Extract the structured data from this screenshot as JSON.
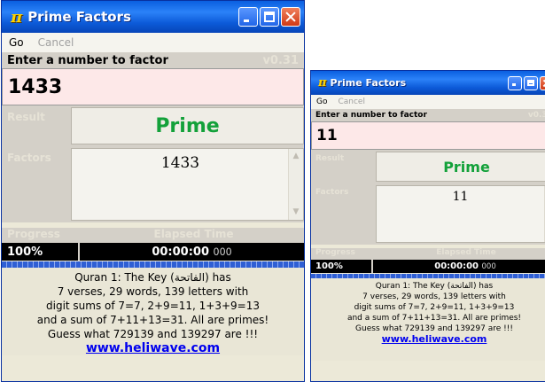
{
  "app": {
    "icon": "pi-icon",
    "title": "Prime Factors",
    "menu": {
      "go": "Go",
      "cancel": "Cancel"
    },
    "prompt": "Enter a number to factor",
    "version": "v0.31",
    "result_label": "Result",
    "factors_label": "Factors",
    "progress_label": "Progress",
    "elapsed_label": "Elapsed Time",
    "info_lines": [
      "Quran 1: The Key (الفاتحة) has",
      "7 verses, 29 words, 139 letters with",
      "digit sums of 7=7, 2+9=11, 1+3+9=13",
      "and a sum of 7+11+13=31. All are primes!",
      "Guess what 729139 and 139297 are !!!"
    ],
    "link": "www.heliwave.com",
    "accent_colors": {
      "title_bar": "#0a5fe0",
      "result_text": "#13a13a",
      "input_bg": "#fde8e8",
      "link": "#0000ee"
    }
  },
  "windows": [
    {
      "number": "1433",
      "result": "Prime",
      "factors": "1433",
      "progress": "100%",
      "elapsed": "00:00:00",
      "elapsed_ms": "000",
      "progress_fraction": 1.0
    },
    {
      "number": "11",
      "result": "Prime",
      "factors": "11",
      "progress": "100%",
      "elapsed": "00:00:00",
      "elapsed_ms": "000",
      "progress_fraction": 1.0
    }
  ]
}
